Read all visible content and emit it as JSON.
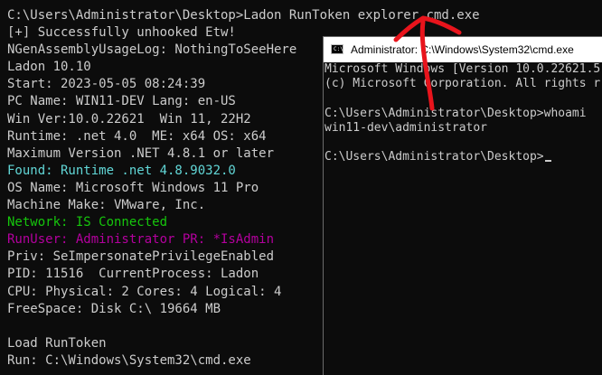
{
  "background_terminal": {
    "command_line": "C:\\Users\\Administrator\\Desktop>Ladon RunToken explorer cmd.exe",
    "lines": [
      {
        "text": "[+] Successfully unhooked Etw!",
        "color": "default"
      },
      {
        "text": "NGenAssemblyUsageLog: NothingToSeeHere",
        "color": "default"
      },
      {
        "text": "Ladon 10.10",
        "color": "default"
      },
      {
        "text": "Start: 2023-05-05 08:24:39",
        "color": "default"
      },
      {
        "text": "PC Name: WIN11-DEV Lang: en-US",
        "color": "default"
      },
      {
        "text": "Win Ver:10.0.22621  Win 11, 22H2",
        "color": "default"
      },
      {
        "text": "Runtime: .net 4.0  ME: x64 OS: x64",
        "color": "default"
      },
      {
        "text": "Maximum Version .NET 4.8.1 or later",
        "color": "default"
      },
      {
        "text": "Found: Runtime .net 4.8.9032.0",
        "color": "cyan"
      },
      {
        "text": "OS Name: Microsoft Windows 11 Pro",
        "color": "default"
      },
      {
        "text": "Machine Make: VMware, Inc.",
        "color": "default"
      },
      {
        "text": "Network: IS Connected",
        "color": "green"
      },
      {
        "text": "RunUser: Administrator PR: *IsAdmin",
        "color": "magenta"
      },
      {
        "text": "Priv: SeImpersonatePrivilegeEnabled",
        "color": "default"
      },
      {
        "text": "PID: 11516  CurrentProcess: Ladon",
        "color": "default"
      },
      {
        "text": "CPU: Physical: 2 Cores: 4 Logical: 4",
        "color": "default"
      },
      {
        "text": "FreeSpace: Disk C:\\ 19664 MB",
        "color": "default"
      },
      {
        "text": "",
        "color": "default"
      },
      {
        "text": "Load RunToken",
        "color": "default"
      },
      {
        "text": "Run: C:\\Windows\\System32\\cmd.exe",
        "color": "default"
      }
    ]
  },
  "cmd_window": {
    "title": "Administrator: C:\\Windows\\System32\\cmd.exe",
    "icon_label": "C:\\",
    "lines": [
      "Microsoft Windows [Version 10.0.22621.5",
      "(c) Microsoft Corporation. All rights r",
      "",
      "C:\\Users\\Administrator\\Desktop>whoami",
      "win11-dev\\administrator",
      "",
      "C:\\Users\\Administrator\\Desktop>"
    ]
  },
  "colors": {
    "default": "#cccccc",
    "cyan": "#61d6d6",
    "green": "#16c60c",
    "magenta": "#b4009e",
    "annotation_red": "#e8141c"
  },
  "icons": {
    "cmd_window_icon": "console-app-icon",
    "annotation": "red-hand-drawn-arrow"
  }
}
